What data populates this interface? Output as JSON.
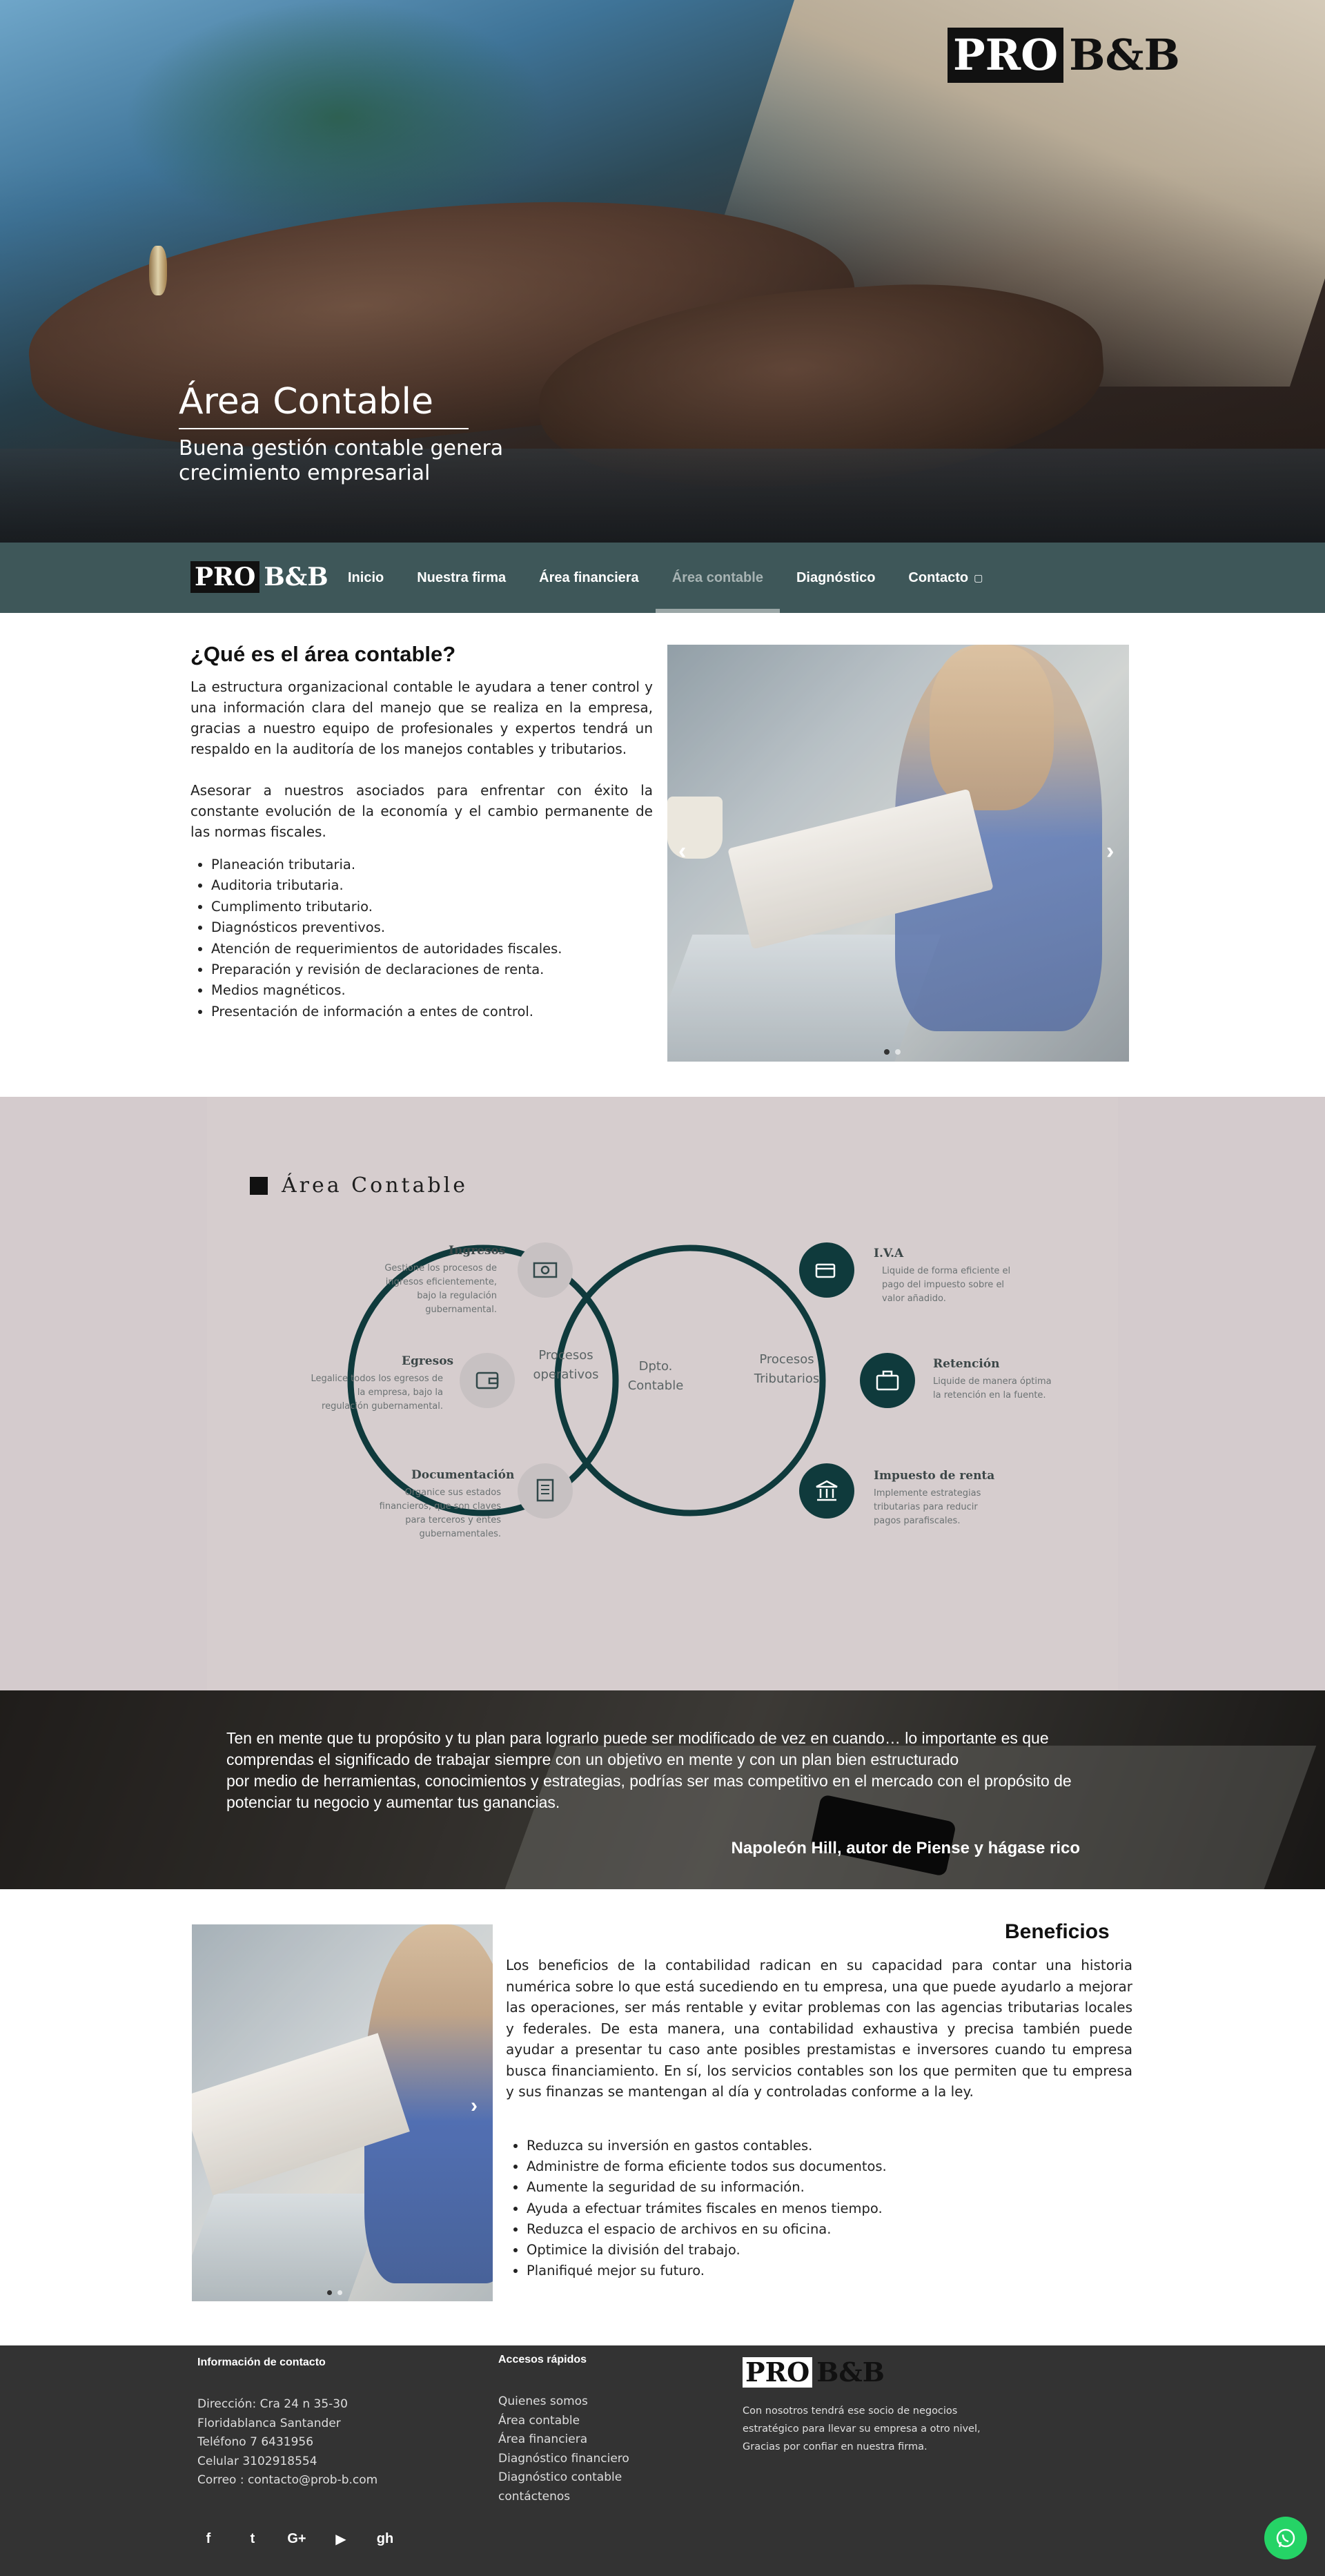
{
  "hero": {
    "logo_pro": "PRO",
    "logo_bb": "B&B",
    "title": "Área Contable",
    "subtitle": "Buena gestión contable genera crecimiento empresarial"
  },
  "nav": {
    "logo_pro": "PRO",
    "logo_bb": "B&B",
    "items": [
      {
        "label": "Inicio"
      },
      {
        "label": "Nuestra firma"
      },
      {
        "label": "Área financiera"
      },
      {
        "label": "Área contable",
        "active": true
      },
      {
        "label": "Diagnóstico"
      },
      {
        "label": "Contacto"
      }
    ]
  },
  "intro": {
    "title": "¿Qué es el área contable?",
    "p1": "La estructura organizacional contable le ayudara a tener control y una información clara del manejo que se realiza en la empresa, gracias a nuestro equipo de profesionales y expertos tendrá un respaldo en la auditoría de los manejos contables y tributarios.",
    "p2": "Asesorar a nuestros asociados para enfrentar con éxito la constante evolución de la economía y el cambio permanente de las normas fiscales.",
    "services": [
      "Planeación tributaria.",
      "Auditoria tributaria.",
      "Cumplimento tributario.",
      "Diagnósticos preventivos.",
      "Atención de requerimientos de autoridades fiscales.",
      "Preparación y revisión de declaraciones de renta.",
      "Medios magnéticos.",
      "Presentación de información a entes de control."
    ],
    "carousel_prev": "‹",
    "carousel_next": "›"
  },
  "diagram": {
    "heading": "Área Contable",
    "center_left": "Procesos operativos",
    "center_mid_1": "Dpto.",
    "center_mid_2": "Contable",
    "center_right_1": "Procesos",
    "center_right_2": "Tributarios",
    "left_items": [
      {
        "label": "Ingresos",
        "desc": "Gestione los procesos de ingresos eficientemente, bajo la regulación gubernamental.",
        "icon": "money-icon"
      },
      {
        "label": "Egresos",
        "desc": "Legalice todos los egresos de la empresa, bajo la regulación gubernamental.",
        "icon": "wallet-icon"
      },
      {
        "label": "Documentación",
        "desc": "Organice sus estados financieros, que son claves para terceros y entes gubernamentales.",
        "icon": "document-icon"
      }
    ],
    "right_items": [
      {
        "label": "I.V.A",
        "desc": "Liquide de forma eficiente el pago del impuesto sobre el valor añadido.",
        "icon": "payment-icon"
      },
      {
        "label": "Retención",
        "desc": "Liquide de manera óptima la retención en la fuente.",
        "icon": "briefcase-icon"
      },
      {
        "label": "Impuesto de renta",
        "desc": "Implemente estrategias tributarias para reducir pagos parafiscales.",
        "icon": "bank-icon"
      }
    ],
    "colors": {
      "ring": "#0f3a3c",
      "light_icon_bg": "#c7c1c2"
    }
  },
  "quote": {
    "text_lines": [
      "Ten en mente que tu propósito y tu plan para lograrlo puede ser modificado de vez en cuando… lo importante es que",
      "comprendas el significado de trabajar siempre con un objetivo en mente y con un plan bien estructurado",
      "por medio de herramientas, conocimientos y estrategias, podrías ser mas competitivo en el mercado con el propósito de",
      "potenciar tu negocio y aumentar tus ganancias."
    ],
    "author": "Napoleón Hill, autor de Piense y hágase rico"
  },
  "benefits": {
    "title": "Beneficios",
    "paragraph": "Los beneficios de la contabilidad radican en su capacidad para contar una historia numérica sobre lo que está sucediendo en tu empresa, una que puede ayudarlo a mejorar las operaciones, ser más rentable y evitar problemas con las agencias tributarias locales y federales. De esta manera, una contabilidad exhaustiva y precisa también puede ayudar a presentar tu caso ante posibles prestamistas e inversores cuando tu empresa busca financiamiento. En sí, los servicios contables son los que permiten que tu empresa y sus finanzas se mantengan al día y controladas conforme a la ley.",
    "items": [
      "Reduzca su inversión en gastos contables.",
      "Administre de forma eficiente todos sus documentos.",
      "Aumente la seguridad de su información.",
      "Ayuda a efectuar trámites fiscales en menos tiempo.",
      "Reduzca el espacio de archivos en su oficina.",
      "Optimice la división del trabajo.",
      "Planifiqué mejor su futuro."
    ],
    "carousel_next": "›"
  },
  "footer": {
    "contact_title": "Información de contacto",
    "contact_lines": [
      "Dirección: Cra 24 n 35-30",
      "Floridablanca Santander",
      "Teléfono 7 6431956",
      "Celular 3102918554",
      "Correo : contacto@prob-b.com"
    ],
    "quick_title": "Accesos rápidos",
    "quick_links": [
      "Quienes somos",
      "Área contable",
      "Área financiera",
      "Diagnóstico financiero",
      "Diagnóstico contable",
      "contáctenos"
    ],
    "logo_pro": "PRO",
    "logo_bb": "B&B",
    "about": "Con nosotros tendrá ese socio de negocios estratégico para llevar su empresa a otro nivel, Gracias por confiar en nuestra firma.",
    "social": [
      "facebook-icon",
      "twitter-icon",
      "google-plus-icon",
      "youtube-icon",
      "github-icon"
    ],
    "social_glyphs": [
      "f",
      "t",
      "G+",
      "▶",
      "gh"
    ]
  }
}
